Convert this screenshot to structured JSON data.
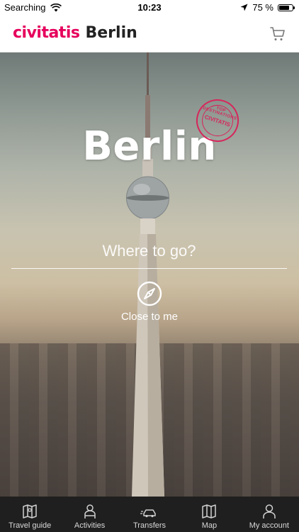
{
  "status_bar": {
    "carrier": "Searching",
    "time": "10:23",
    "battery_percent": "75 %",
    "battery_level": 0.75
  },
  "header": {
    "brand": "civitatis",
    "city": "Berlin",
    "cart_icon": "shopping-cart-icon",
    "brand_color": "#e6005c"
  },
  "hero": {
    "title": "Berlin",
    "stamp_top": "TOP DESTINATIONS",
    "stamp_brand": "CIVITATIS",
    "search_placeholder": "Where to go?",
    "close_to_me_label": "Close to me",
    "close_to_me_icon": "compass-icon",
    "stamp_color": "#d6265a"
  },
  "tabbar": {
    "items": [
      {
        "label": "Travel guide",
        "icon": "map-book-icon"
      },
      {
        "label": "Activities",
        "icon": "person-icon"
      },
      {
        "label": "Transfers",
        "icon": "car-transfer-icon"
      },
      {
        "label": "Map",
        "icon": "map-icon"
      },
      {
        "label": "My account",
        "icon": "user-icon"
      }
    ]
  }
}
